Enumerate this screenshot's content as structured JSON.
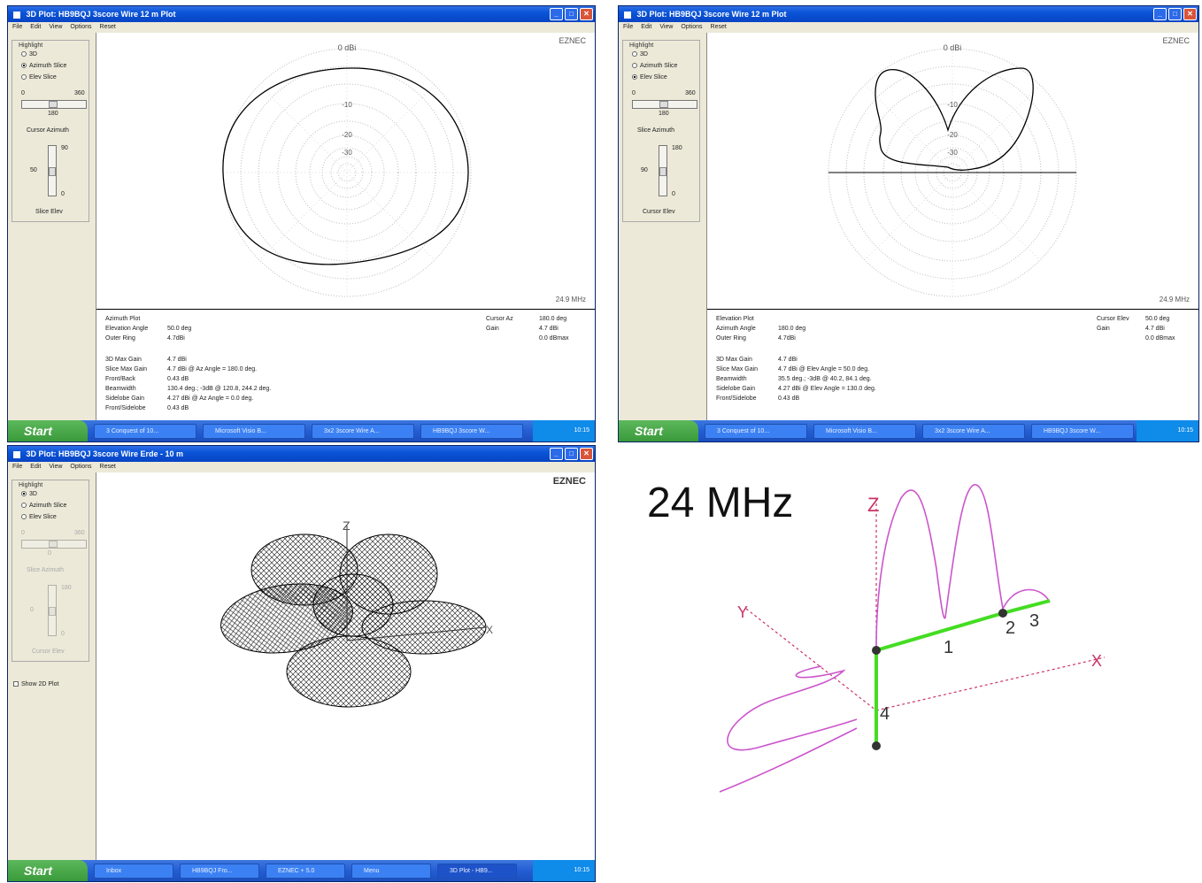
{
  "windows": {
    "azimuth": {
      "title": "3D Plot: HB9BQJ 3score Wire 12 m Plot",
      "menu": [
        "File",
        "Edit",
        "View",
        "Options",
        "Reset"
      ],
      "highlight_label": "Highlight",
      "radios": [
        "3D",
        "Azimuth Slice",
        "Elev Slice"
      ],
      "radio_selected": 1,
      "scale_min": "0",
      "scale_max": "360",
      "scroll_value": "180",
      "cursor_label": "Cursor Azimuth",
      "vmax": "90",
      "vmid": "50",
      "vmin": "0",
      "slice_label": "Slice Elev",
      "logo": "EZNEC",
      "freq": "24.9 MHz",
      "ring_labels": [
        "0 dBi",
        "-10",
        "-20",
        "-30"
      ],
      "info_left": [
        "Azimuth Plot",
        "Elevation Angle",
        "Outer Ring"
      ],
      "info_left_vals": [
        "50.0 deg",
        "4.7dBi"
      ],
      "info_right": [
        "Cursor Az",
        "Gain"
      ],
      "info_right_vals": [
        "180.0 deg",
        "4.7 dBi",
        "0.0 dBmax"
      ],
      "info_lower": [
        "3D Max Gain",
        "Slice Max Gain",
        "Front/Back",
        "Beamwidth",
        "Sidelobe Gain",
        "Front/Sidelobe"
      ],
      "info_lower_vals": [
        "4.7 dBi",
        "4.7 dBi @ Az Angle = 180.0 deg.",
        "0.43 dB",
        "130.4 deg.; -3dB @ 120.8, 244.2 deg.",
        "4.27 dBi @ Az Angle = 0.0 deg.",
        "0.43 dB"
      ]
    },
    "elevation": {
      "title": "3D Plot: HB9BQJ 3score Wire 12 m Plot",
      "menu": [
        "File",
        "Edit",
        "View",
        "Options",
        "Reset"
      ],
      "highlight_label": "Highlight",
      "radios": [
        "3D",
        "Azimuth Slice",
        "Elev Slice"
      ],
      "radio_selected": 2,
      "scale_min": "0",
      "scale_max": "360",
      "scroll_value": "180",
      "cursor_label": "Slice Azimuth",
      "vmax": "180",
      "vmid": "90",
      "vmin": "0",
      "slice_label": "Cursor Elev",
      "logo": "EZNEC",
      "freq": "24.9 MHz",
      "ring_labels": [
        "0 dBi",
        "-10",
        "-20",
        "-30"
      ],
      "info_left": [
        "Elevation Plot",
        "Azimuth Angle",
        "Outer Ring"
      ],
      "info_left_vals": [
        "180.0 deg",
        "4.7dBi"
      ],
      "info_right": [
        "Cursor Elev",
        "Gain"
      ],
      "info_right_vals": [
        "50.0 deg",
        "4.7 dBi",
        "0.0 dBmax"
      ],
      "info_lower": [
        "3D Max Gain",
        "Slice Max Gain",
        "Beamwidth",
        "Sidelobe Gain",
        "Front/Sidelobe"
      ],
      "info_lower_vals": [
        "4.7 dBi",
        "4.7 dBi @ Elev Angle = 50.0 deg.",
        "35.5 deg.; -3dB @ 40.2, 84.1 deg.",
        "4.27 dBi @ Elev Angle = 130.0 deg.",
        "0.43 dB"
      ]
    },
    "threed": {
      "title": "3D Plot: HB9BQJ 3score Wire Erde - 10 m",
      "menu": [
        "File",
        "Edit",
        "View",
        "Options",
        "Reset"
      ],
      "highlight_label": "Highlight",
      "radios": [
        "3D",
        "Azimuth Slice",
        "Elev Slice"
      ],
      "radio_selected": 0,
      "scale_min": "0",
      "scale_max": "360",
      "scroll_value": "0",
      "cursor_label": "Slice Azimuth",
      "vmax": "180",
      "vmid": "0",
      "vmin": "0",
      "slice_label": "Cursor Elev",
      "show2d_label": "Show 2D Plot",
      "logo": "EZNEC",
      "axis_z": "Z",
      "axis_x": "X"
    }
  },
  "taskbars": {
    "top_left": {
      "start": "Start",
      "items": [
        "3 Conquest of 10...",
        "Microsoft Visio B...",
        "3x2 3score Wire A...",
        "HB9BQJ 3score W..."
      ],
      "tray": "10:15"
    },
    "top_right": {
      "start": "Start",
      "items": [
        "3 Conquest of 10...",
        "Microsoft Visio B...",
        "3x2 3score Wire A...",
        "HB9BQJ 3score W..."
      ],
      "tray": "10:15"
    },
    "bottom": {
      "start": "Start",
      "items": [
        "Inbox",
        "HB9BQJ Fro...",
        "EZNEC + 5.0",
        "Menu",
        "3D Plot - HB9..."
      ],
      "tray": "10:15"
    }
  },
  "antenna": {
    "title": "24 MHz",
    "axis_z": "Z",
    "axis_y": "Y",
    "axis_x": "X",
    "wire_labels": [
      "1",
      "2",
      "3",
      "4"
    ],
    "colors": {
      "wire": "#44dd22",
      "current": "#cc55cc",
      "axis": "#cc3366"
    }
  }
}
